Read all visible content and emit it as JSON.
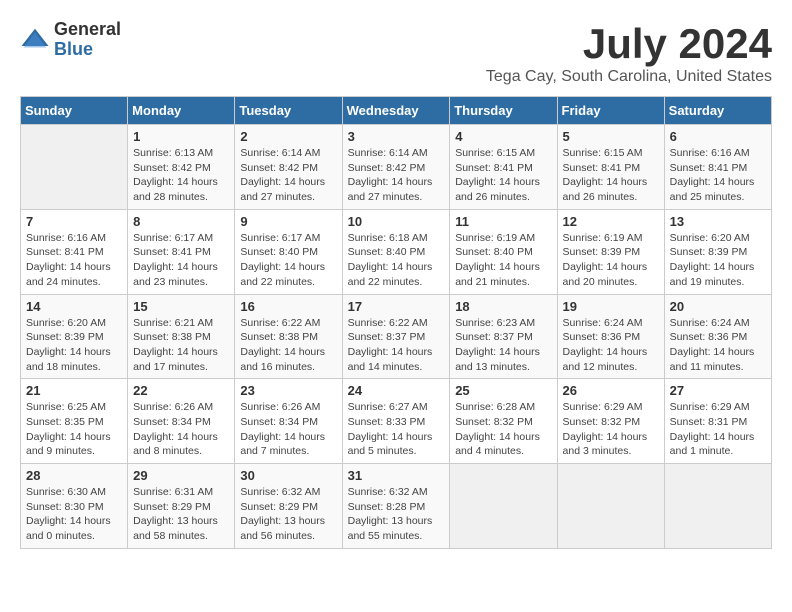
{
  "logo": {
    "general": "General",
    "blue": "Blue"
  },
  "title": "July 2024",
  "location": "Tega Cay, South Carolina, United States",
  "days_of_week": [
    "Sunday",
    "Monday",
    "Tuesday",
    "Wednesday",
    "Thursday",
    "Friday",
    "Saturday"
  ],
  "weeks": [
    [
      {
        "day": "",
        "info": ""
      },
      {
        "day": "1",
        "info": "Sunrise: 6:13 AM\nSunset: 8:42 PM\nDaylight: 14 hours and 28 minutes."
      },
      {
        "day": "2",
        "info": "Sunrise: 6:14 AM\nSunset: 8:42 PM\nDaylight: 14 hours and 27 minutes."
      },
      {
        "day": "3",
        "info": "Sunrise: 6:14 AM\nSunset: 8:42 PM\nDaylight: 14 hours and 27 minutes."
      },
      {
        "day": "4",
        "info": "Sunrise: 6:15 AM\nSunset: 8:41 PM\nDaylight: 14 hours and 26 minutes."
      },
      {
        "day": "5",
        "info": "Sunrise: 6:15 AM\nSunset: 8:41 PM\nDaylight: 14 hours and 26 minutes."
      },
      {
        "day": "6",
        "info": "Sunrise: 6:16 AM\nSunset: 8:41 PM\nDaylight: 14 hours and 25 minutes."
      }
    ],
    [
      {
        "day": "7",
        "info": "Sunrise: 6:16 AM\nSunset: 8:41 PM\nDaylight: 14 hours and 24 minutes."
      },
      {
        "day": "8",
        "info": "Sunrise: 6:17 AM\nSunset: 8:41 PM\nDaylight: 14 hours and 23 minutes."
      },
      {
        "day": "9",
        "info": "Sunrise: 6:17 AM\nSunset: 8:40 PM\nDaylight: 14 hours and 22 minutes."
      },
      {
        "day": "10",
        "info": "Sunrise: 6:18 AM\nSunset: 8:40 PM\nDaylight: 14 hours and 22 minutes."
      },
      {
        "day": "11",
        "info": "Sunrise: 6:19 AM\nSunset: 8:40 PM\nDaylight: 14 hours and 21 minutes."
      },
      {
        "day": "12",
        "info": "Sunrise: 6:19 AM\nSunset: 8:39 PM\nDaylight: 14 hours and 20 minutes."
      },
      {
        "day": "13",
        "info": "Sunrise: 6:20 AM\nSunset: 8:39 PM\nDaylight: 14 hours and 19 minutes."
      }
    ],
    [
      {
        "day": "14",
        "info": "Sunrise: 6:20 AM\nSunset: 8:39 PM\nDaylight: 14 hours and 18 minutes."
      },
      {
        "day": "15",
        "info": "Sunrise: 6:21 AM\nSunset: 8:38 PM\nDaylight: 14 hours and 17 minutes."
      },
      {
        "day": "16",
        "info": "Sunrise: 6:22 AM\nSunset: 8:38 PM\nDaylight: 14 hours and 16 minutes."
      },
      {
        "day": "17",
        "info": "Sunrise: 6:22 AM\nSunset: 8:37 PM\nDaylight: 14 hours and 14 minutes."
      },
      {
        "day": "18",
        "info": "Sunrise: 6:23 AM\nSunset: 8:37 PM\nDaylight: 14 hours and 13 minutes."
      },
      {
        "day": "19",
        "info": "Sunrise: 6:24 AM\nSunset: 8:36 PM\nDaylight: 14 hours and 12 minutes."
      },
      {
        "day": "20",
        "info": "Sunrise: 6:24 AM\nSunset: 8:36 PM\nDaylight: 14 hours and 11 minutes."
      }
    ],
    [
      {
        "day": "21",
        "info": "Sunrise: 6:25 AM\nSunset: 8:35 PM\nDaylight: 14 hours and 9 minutes."
      },
      {
        "day": "22",
        "info": "Sunrise: 6:26 AM\nSunset: 8:34 PM\nDaylight: 14 hours and 8 minutes."
      },
      {
        "day": "23",
        "info": "Sunrise: 6:26 AM\nSunset: 8:34 PM\nDaylight: 14 hours and 7 minutes."
      },
      {
        "day": "24",
        "info": "Sunrise: 6:27 AM\nSunset: 8:33 PM\nDaylight: 14 hours and 5 minutes."
      },
      {
        "day": "25",
        "info": "Sunrise: 6:28 AM\nSunset: 8:32 PM\nDaylight: 14 hours and 4 minutes."
      },
      {
        "day": "26",
        "info": "Sunrise: 6:29 AM\nSunset: 8:32 PM\nDaylight: 14 hours and 3 minutes."
      },
      {
        "day": "27",
        "info": "Sunrise: 6:29 AM\nSunset: 8:31 PM\nDaylight: 14 hours and 1 minute."
      }
    ],
    [
      {
        "day": "28",
        "info": "Sunrise: 6:30 AM\nSunset: 8:30 PM\nDaylight: 14 hours and 0 minutes."
      },
      {
        "day": "29",
        "info": "Sunrise: 6:31 AM\nSunset: 8:29 PM\nDaylight: 13 hours and 58 minutes."
      },
      {
        "day": "30",
        "info": "Sunrise: 6:32 AM\nSunset: 8:29 PM\nDaylight: 13 hours and 56 minutes."
      },
      {
        "day": "31",
        "info": "Sunrise: 6:32 AM\nSunset: 8:28 PM\nDaylight: 13 hours and 55 minutes."
      },
      {
        "day": "",
        "info": ""
      },
      {
        "day": "",
        "info": ""
      },
      {
        "day": "",
        "info": ""
      }
    ]
  ]
}
